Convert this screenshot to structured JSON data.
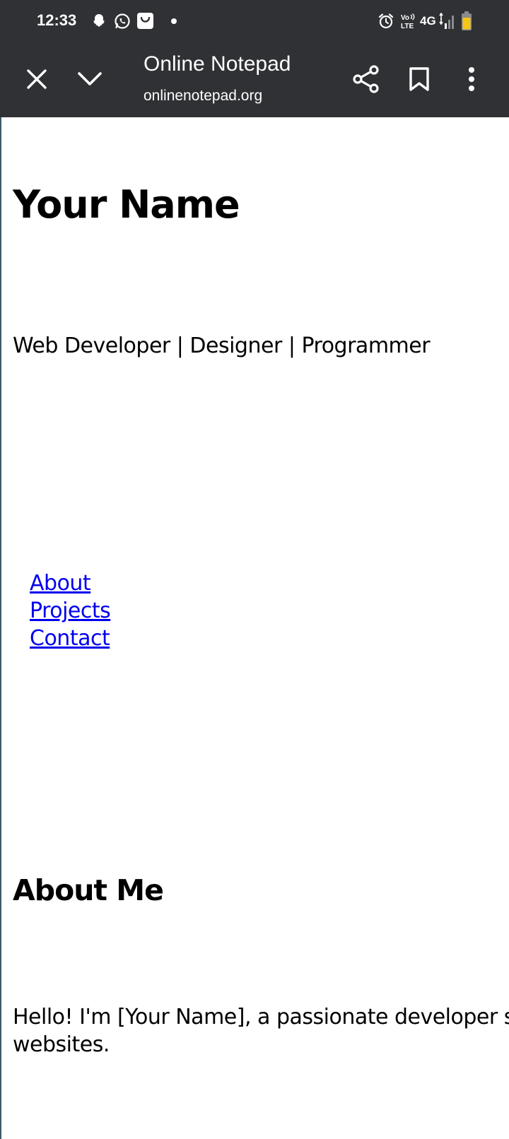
{
  "status_bar": {
    "time": "12:33",
    "network": "4G",
    "volte": "Vo LTE",
    "left_icons": [
      "snapchat-icon",
      "whatsapp-icon",
      "shopping-bag-icon",
      "notification-dot-icon"
    ],
    "right_icons": [
      "alarm-icon",
      "volte-icon",
      "signal-icon",
      "battery-icon"
    ],
    "battery_color": "#f5c518"
  },
  "toolbar": {
    "title": "Online Notepad",
    "url": "onlinenotepad.org",
    "background": "#303135",
    "icons": [
      "close-icon",
      "chevron-down-icon",
      "share-icon",
      "bookmark-icon",
      "more-vert-icon"
    ]
  },
  "page": {
    "name": "Your Name",
    "tagline": "Web Developer | Designer | Programmer",
    "nav": [
      "About",
      "Projects",
      "Contact"
    ],
    "about_heading": "About Me",
    "about_text_line1": "Hello! I'm [Your Name], a passionate developer ski",
    "about_text_line2": "websites.",
    "link_color": "#0000ee"
  }
}
